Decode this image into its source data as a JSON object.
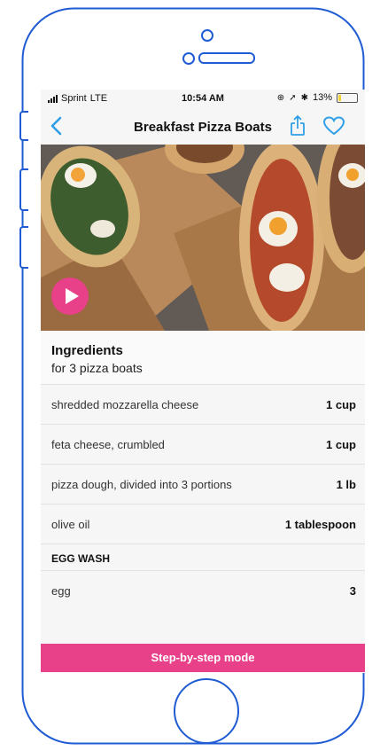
{
  "status_bar": {
    "carrier": "Sprint",
    "network": "LTE",
    "time": "10:54 AM",
    "battery": "13%",
    "battery_level": 0.13
  },
  "nav": {
    "title": "Breakfast Pizza Boats",
    "back_icon": "chevron-left-icon",
    "share_icon": "share-icon",
    "favorite_icon": "heart-icon"
  },
  "ingredients": {
    "title": "Ingredients",
    "subtitle": "for 3 pizza boats",
    "items": [
      {
        "name": "shredded mozzarella cheese",
        "qty": "1 cup"
      },
      {
        "name": "feta cheese, crumbled",
        "qty": "1 cup"
      },
      {
        "name": "pizza dough, divided into 3 portions",
        "qty": "1 lb"
      },
      {
        "name": "olive oil",
        "qty": "1 tablespoon"
      }
    ],
    "section": "EGG WASH",
    "section_items": [
      {
        "name": "egg",
        "qty": "3"
      }
    ]
  },
  "cta": {
    "label": "Step-by-step mode"
  },
  "colors": {
    "accent": "#e8418a",
    "frame": "#1f5bd3",
    "link": "#2f9fe6"
  }
}
